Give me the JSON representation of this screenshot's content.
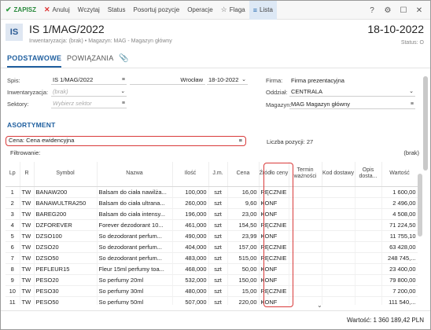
{
  "toolbar": {
    "save": "ZAPISZ",
    "cancel": "Anuluj",
    "load": "Wczytaj",
    "status": "Status",
    "sort": "Posortuj pozycje",
    "operations": "Operacje",
    "flag": "Flaga",
    "list": "Lista",
    "help_icon": "help-icon",
    "settings_icon": "gear-icon"
  },
  "header": {
    "badge": "IS",
    "title": "IS 1/MAG/2022",
    "subtitle": "Inwentaryzacja: (brak)  •  Magazyn: MAG - Magazyn główny",
    "date": "18-10-2022",
    "status": "Status: O"
  },
  "tabs": {
    "basic": "PODSTAWOWE",
    "links": "POWIĄZANIA"
  },
  "form": {
    "spis_label": "Spis:",
    "spis_value": "IS 1/MAG/2022",
    "place_value": "Wrocław",
    "date_value": "18-10-2022",
    "inwent_label": "Inwentaryzacja:",
    "inwent_value": "(brak)",
    "sektory_label": "Sektory:",
    "sektory_placeholder": "Wybierz sektor",
    "firma_label": "Firma:",
    "firma_value": "Firma prezentacyjna",
    "oddzial_label": "Oddział:",
    "oddzial_value": "CENTRALA",
    "magazyn_label": "Magazyn:",
    "magazyn_value": "MAG  Magazyn główny"
  },
  "assort": {
    "title": "ASORTYMENT",
    "price": "Cena: Cena ewidencyjna",
    "count": "Liczba pozycji: 27",
    "filter_label": "Filtrowanie:",
    "filter_value": "(brak)"
  },
  "columns": [
    "Lp",
    "R",
    "Symbol",
    "Nazwa",
    "Ilość",
    "J.m.",
    "Cena",
    "Źródło ceny",
    "Termin ważności",
    "Kod dostawy",
    "Opis dosta...",
    "Wartość"
  ],
  "rows": [
    [
      "1",
      "TW",
      "BANAW200",
      "Balsam do ciała nawilża...",
      "100,000",
      "szt",
      "16,00",
      "RĘCZNIE",
      "",
      "",
      "",
      "1 600,00"
    ],
    [
      "2",
      "TW",
      "BANAWULTRA250",
      "Balsam do ciała ultrana...",
      "260,000",
      "szt",
      "9,60",
      "KONF",
      "",
      "",
      "",
      "2 496,00"
    ],
    [
      "3",
      "TW",
      "BAREG200",
      "Balsam do ciała intensy...",
      "196,000",
      "szt",
      "23,00",
      "KONF",
      "",
      "",
      "",
      "4 508,00"
    ],
    [
      "4",
      "TW",
      "DZFOREVER",
      "Forever dezodorant 10...",
      "461,000",
      "szt",
      "154,50",
      "RĘCZNIE",
      "",
      "",
      "",
      "71 224,50"
    ],
    [
      "5",
      "TW",
      "DZSO100",
      "So dezodorant perfum...",
      "490,000",
      "szt",
      "23,99",
      "KONF",
      "",
      "",
      "",
      "11 755,10"
    ],
    [
      "6",
      "TW",
      "DZSO20",
      "So dezodorant perfum...",
      "404,000",
      "szt",
      "157,00",
      "RĘCZNIE",
      "",
      "",
      "",
      "63 428,00"
    ],
    [
      "7",
      "TW",
      "DZSO50",
      "So dezodorant perfum...",
      "483,000",
      "szt",
      "515,00",
      "RĘCZNIE",
      "",
      "",
      "",
      "248 745,..."
    ],
    [
      "8",
      "TW",
      "PEFLEUR15",
      "Fleur 15ml perfumy toa...",
      "468,000",
      "szt",
      "50,00",
      "KONF",
      "",
      "",
      "",
      "23 400,00"
    ],
    [
      "9",
      "TW",
      "PESO20",
      "So perfumy 20ml",
      "532,000",
      "szt",
      "150,00",
      "KONF",
      "",
      "",
      "",
      "79 800,00"
    ],
    [
      "10",
      "TW",
      "PESO30",
      "So perfumy 30ml",
      "480,000",
      "szt",
      "15,00",
      "RĘCZNIE",
      "",
      "",
      "",
      "7 200,00"
    ],
    [
      "11",
      "TW",
      "PESO50",
      "So perfumy 50ml",
      "507,000",
      "szt",
      "220,00",
      "KONF",
      "",
      "",
      "",
      "111 540,..."
    ]
  ],
  "footer": {
    "total": "Wartość:  1 360 189,42 PLN"
  }
}
